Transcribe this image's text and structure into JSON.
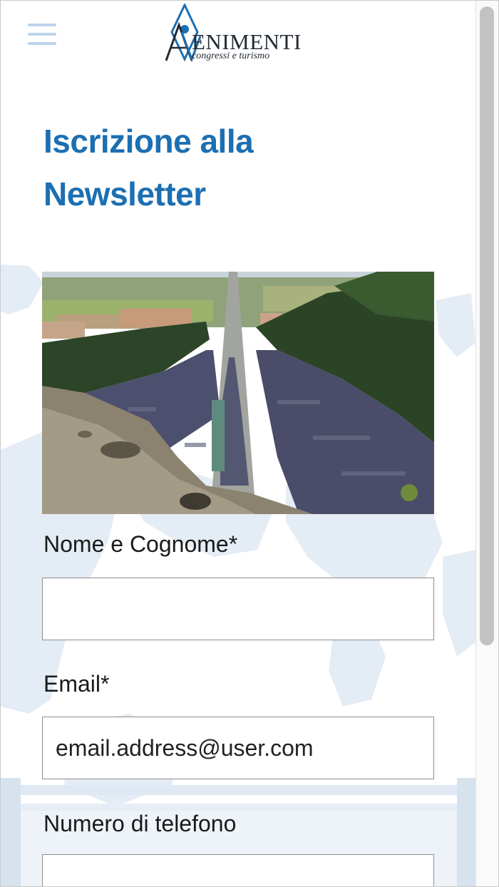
{
  "logo": {
    "brand_text": "ENIMENTI",
    "tagline": "congressi e turismo",
    "icon": "avvenimenti-diamond-logo-icon"
  },
  "header": {
    "menu_icon": "hamburger-menu-icon"
  },
  "page": {
    "title": "Iscrizione alla Newsletter"
  },
  "hero_image": {
    "subject": "aerial-crowd-photo"
  },
  "form": {
    "name_label": "Nome e Cognome*",
    "name_value": "",
    "email_label": "Email*",
    "email_value": "email.address@user.com",
    "phone_label": "Numero di telefono",
    "phone_value": ""
  },
  "colors": {
    "title": "#1c6fb2",
    "menu_icon": "#bcd3ea",
    "background_map": "#dfe8f3"
  }
}
